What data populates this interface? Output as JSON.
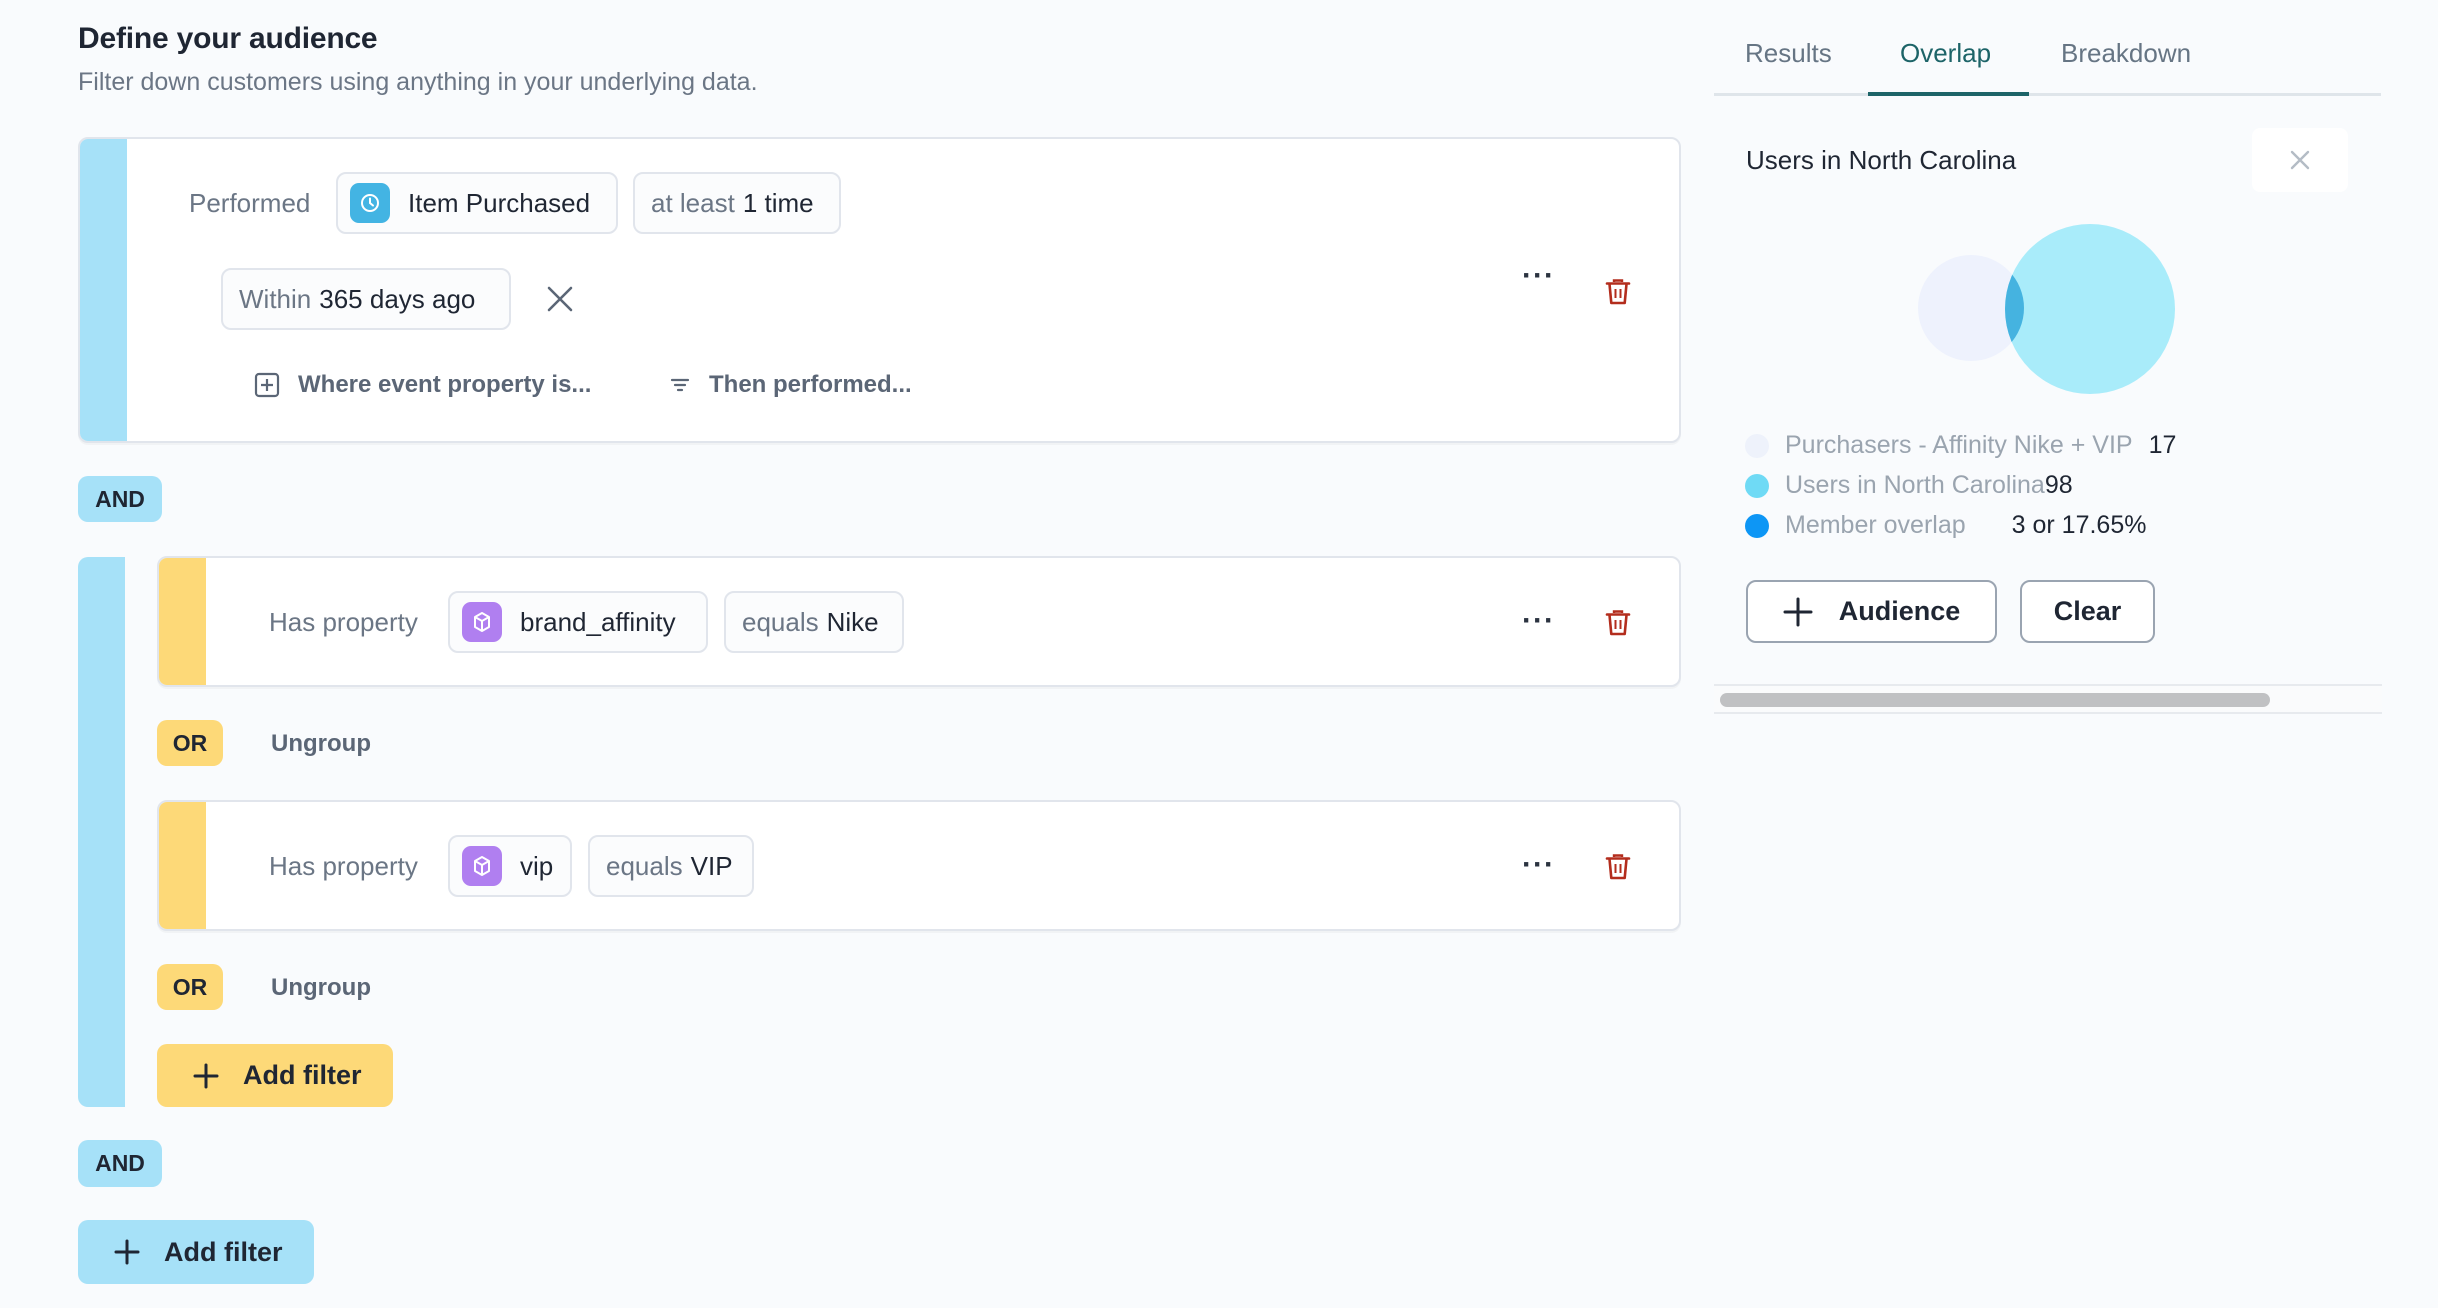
{
  "header": {
    "title": "Define your audience",
    "subtitle": "Filter down customers using anything in your underlying data."
  },
  "event_filter": {
    "prefix": "Performed",
    "event_icon": "clock-icon",
    "event_name": "Item Purchased",
    "frequency_muted": "at least",
    "frequency_value": "1 time",
    "time_muted": "Within",
    "time_value": "365 days ago",
    "where_label": "Where event property is...",
    "then_label": "Then performed..."
  },
  "connectors": {
    "and_1": "AND",
    "and_2": "AND",
    "or_1": "OR",
    "or_2": "OR",
    "ungroup_1": "Ungroup",
    "ungroup_2": "Ungroup"
  },
  "property_filters": [
    {
      "prefix": "Has property",
      "icon": "cube-icon",
      "property": "brand_affinity",
      "operator": "equals",
      "value": "Nike"
    },
    {
      "prefix": "Has property",
      "icon": "cube-icon",
      "property": "vip",
      "operator": "equals",
      "value": "VIP"
    }
  ],
  "buttons": {
    "group_add_filter": "Add filter",
    "main_add_filter": "Add filter",
    "more": "···"
  },
  "right_panel": {
    "tabs": [
      {
        "label": "Results",
        "active": false
      },
      {
        "label": "Overlap",
        "active": true
      },
      {
        "label": "Breakdown",
        "active": false
      }
    ],
    "title": "Users in North Carolina",
    "legend": [
      {
        "label": "Purchasers - Affinity Nike + VIP",
        "value": "17",
        "color": "#eef2fb"
      },
      {
        "label": "Users in North Carolina",
        "value": "98",
        "color": "#6fdaf5"
      },
      {
        "label": "Member overlap",
        "value": "3 or 17.65%",
        "color": "#0d96f5"
      }
    ],
    "add_audience_label": "Audience",
    "clear_label": "Clear"
  },
  "colors": {
    "group_blue": "#a6e1f8",
    "group_yellow": "#fdd978",
    "accent_teal": "#1d6468",
    "trash_red": "#b32d1d",
    "event_icon_bg": "#43b4e3",
    "property_icon_bg": "#b07ff0"
  }
}
